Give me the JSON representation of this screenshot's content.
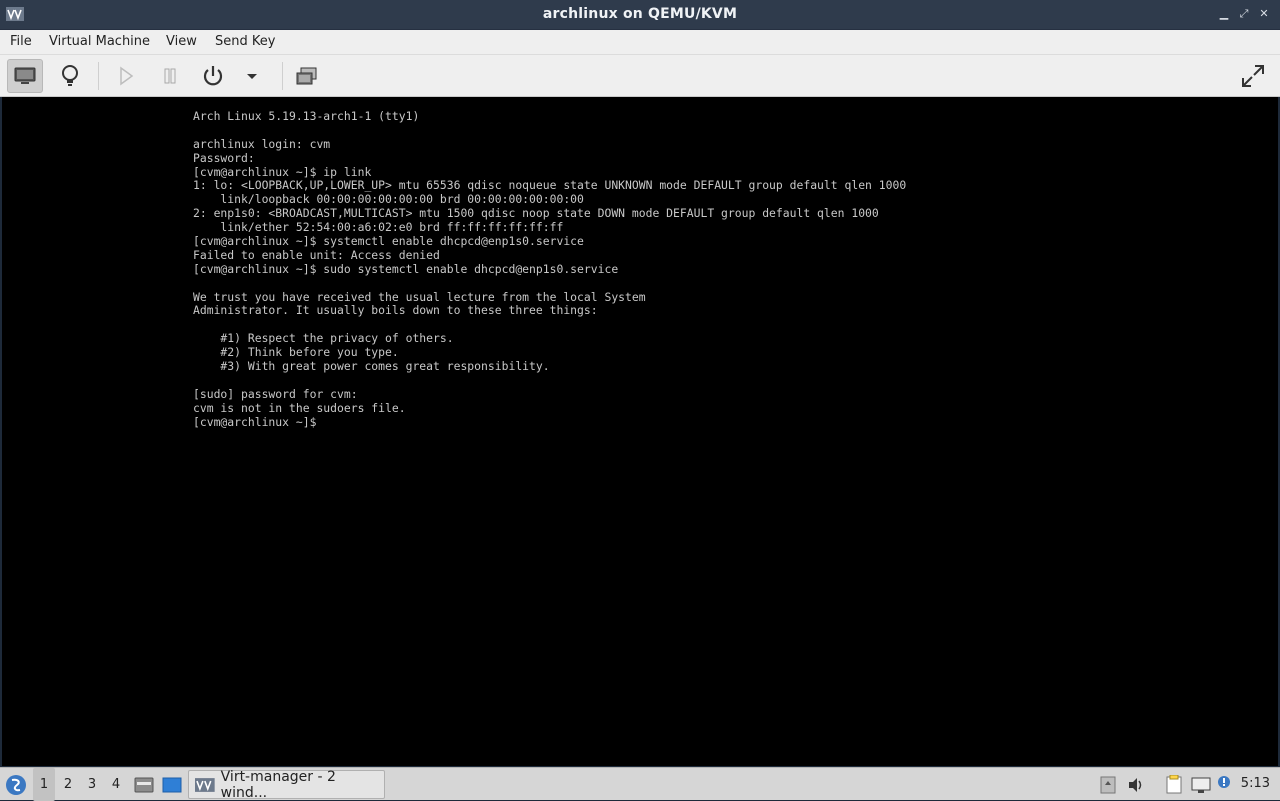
{
  "window": {
    "title": "archlinux on QEMU/KVM"
  },
  "menubar": {
    "items": [
      "File",
      "Virtual Machine",
      "View",
      "Send Key"
    ]
  },
  "toolbar": {
    "buttons": [
      "console-icon",
      "lightbulb-icon",
      "play-icon",
      "pause-icon",
      "power-icon",
      "dropdown-arrow-icon",
      "snapshots-icon",
      "fullscreen-icon"
    ]
  },
  "console": {
    "lines": [
      "Arch Linux 5.19.13-arch1-1 (tty1)",
      "",
      "archlinux login: cvm",
      "Password:",
      "[cvm@archlinux ~]$ ip link",
      "1: lo: <LOOPBACK,UP,LOWER_UP> mtu 65536 qdisc noqueue state UNKNOWN mode DEFAULT group default qlen 1000",
      "    link/loopback 00:00:00:00:00:00 brd 00:00:00:00:00:00",
      "2: enp1s0: <BROADCAST,MULTICAST> mtu 1500 qdisc noop state DOWN mode DEFAULT group default qlen 1000",
      "    link/ether 52:54:00:a6:02:e0 brd ff:ff:ff:ff:ff:ff",
      "[cvm@archlinux ~]$ systemctl enable dhcpcd@enp1s0.service",
      "Failed to enable unit: Access denied",
      "[cvm@archlinux ~]$ sudo systemctl enable dhcpcd@enp1s0.service",
      "",
      "We trust you have received the usual lecture from the local System",
      "Administrator. It usually boils down to these three things:",
      "",
      "    #1) Respect the privacy of others.",
      "    #2) Think before you type.",
      "    #3) With great power comes great responsibility.",
      "",
      "[sudo] password for cvm:",
      "cvm is not in the sudoers file.",
      "[cvm@archlinux ~]$"
    ]
  },
  "taskbar": {
    "workspaces": [
      "1",
      "2",
      "3",
      "4"
    ],
    "active_workspace": "1",
    "task_label": "Virt-manager - 2 wind...",
    "clock": "5:13"
  },
  "colors": {
    "titlebar": "#2f3b4c",
    "console_bg": "#000000",
    "console_text": "#c8c8c8",
    "taskbar": "#d6d6d6"
  }
}
